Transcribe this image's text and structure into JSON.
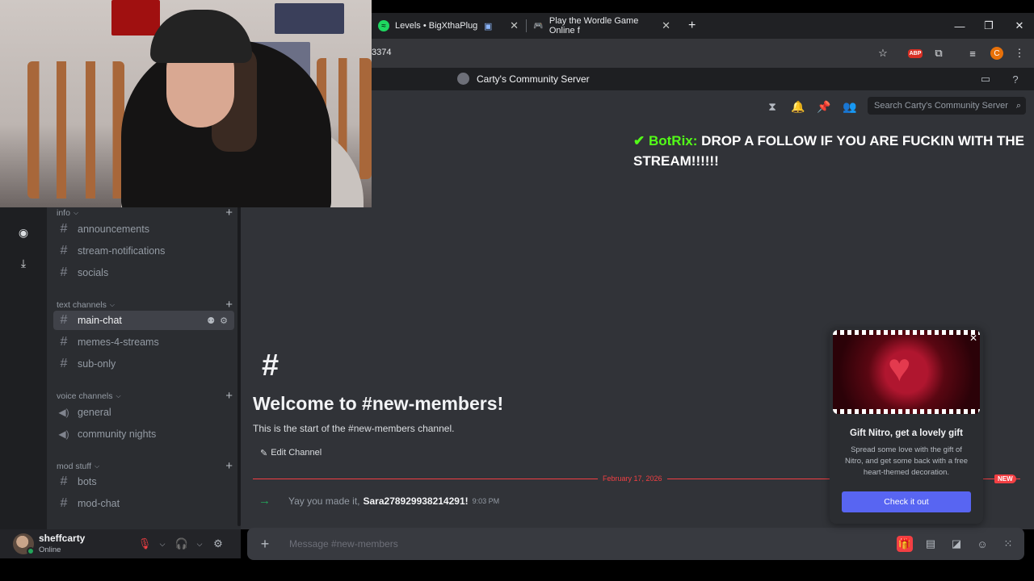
{
  "browser": {
    "tabs": [
      {
        "title": "Levels • BigXthaPlug",
        "icon": "spotify-icon",
        "close": "✕"
      },
      {
        "title": "Play the Wordle Game Online f",
        "icon": "game-controller-icon",
        "close": "✕"
      }
    ],
    "new_tab": "+",
    "url_fragment": "3374",
    "window": {
      "minimize": "—",
      "restore": "❐",
      "close": "✕"
    },
    "profile_initial": "C",
    "abp_label": "ABP"
  },
  "discord": {
    "server_name": "Carty's Community Server",
    "search_placeholder": "Search Carty's Community Server",
    "categories": [
      {
        "name": "info",
        "channels": [
          "announcements",
          "stream-notifications",
          "socials"
        ]
      },
      {
        "name": "text channels",
        "channels": [
          "main-chat",
          "memes-4-streams",
          "sub-only"
        ]
      },
      {
        "name": "voice channels",
        "channels": [
          "general",
          "community nights"
        ]
      },
      {
        "name": "mod stuff",
        "channels": [
          "bots",
          "mod-chat"
        ]
      }
    ],
    "active_channel": "main-chat",
    "user": {
      "name": "sheffcarty",
      "status": "Online"
    },
    "overlay": {
      "bot_name": "BotRix:",
      "message": "DROP A FOLLOW IF YOU ARE FUCKIN WITH THE STREAM!!!!!!"
    },
    "welcome": {
      "hash": "#",
      "title": "Welcome to #new-members!",
      "subtitle": "This is the start of the #new-members channel.",
      "edit_button": "Edit Channel"
    },
    "divider": {
      "date": "February 17, 2026",
      "badge": "NEW"
    },
    "join_message": {
      "text": "Yay you made it,",
      "user": "Sara278929938214291!",
      "time": "9:03 PM"
    },
    "composer": {
      "placeholder": "Message #new-members",
      "plus": "+"
    },
    "nitro_popup": {
      "title": "Gift Nitro, get a lovely gift",
      "body": "Spread some love with the gift of Nitro, and get some back with a free heart-themed decoration.",
      "cta": "Check it out",
      "close": "✕"
    },
    "colors": {
      "accent": "#5865f2",
      "online": "#23a55a",
      "new": "#f23f43",
      "kick_green": "#53fc18"
    }
  }
}
